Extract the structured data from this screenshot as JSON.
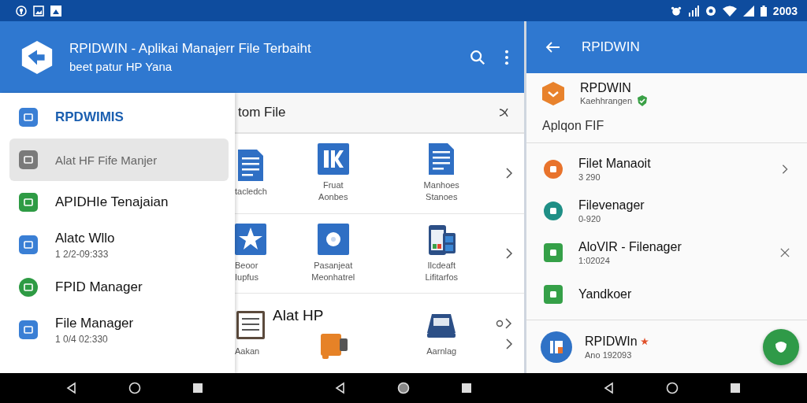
{
  "status_bar": {
    "time": "2003"
  },
  "main": {
    "app_bar": {
      "title": "RPIDWIN - Aplikai Manajerr File Terbaiht",
      "subtitle": "beet patur HP Yana"
    },
    "drawer": [
      {
        "kind": "brand",
        "label": "RPDWIMIS",
        "selected": false,
        "color": "#3a7fd5"
      },
      {
        "kind": "item",
        "label": "Alat HF Fife Manjer",
        "selected": true,
        "color": "#7a7a7a"
      },
      {
        "kind": "item",
        "label": "APIDHIe Tenajaian",
        "selected": false,
        "color": "#2e9b44"
      },
      {
        "kind": "item",
        "label": "Alatc Wllo",
        "detail": "1 2/2-09:333",
        "selected": false,
        "color": "#3a7fd5"
      },
      {
        "kind": "round",
        "label": "FPID Manager",
        "selected": false,
        "color": "#2e9b44"
      },
      {
        "kind": "item",
        "label": "File Manager",
        "detail": "1 0/4 02:330",
        "selected": false,
        "color": "#3a7fd5"
      }
    ],
    "search": {
      "value": "tom File"
    },
    "grid": [
      {
        "cells": [
          {
            "kind": "doc",
            "lines": [
              "tacledch"
            ]
          },
          {
            "kind": "letter",
            "lines": [
              "Fruat",
              "Aonbes"
            ]
          },
          {
            "kind": "doc",
            "lines": [
              "Manhoes",
              "Stanoes"
            ]
          }
        ],
        "actions": [
          {
            "kind": "chevron"
          }
        ]
      },
      {
        "cells": [
          {
            "kind": "star",
            "lines": [
              "Beoor",
              "Iupfus"
            ]
          },
          {
            "kind": "disc",
            "lines": [
              "Pasanjeat",
              "Meonhatrel"
            ]
          },
          {
            "kind": "phone",
            "lines": [
              "Ilcdeaft",
              "Lifitarfos"
            ]
          }
        ],
        "actions": [
          {
            "kind": "chevron"
          }
        ]
      },
      {
        "cells": [
          {
            "kind": "list",
            "lines": [
              "Aakan"
            ]
          },
          {
            "kind": "box",
            "heading": "Alat HP"
          },
          {
            "kind": "scanner",
            "lines": [
              "Aarnlag"
            ]
          }
        ],
        "actions": [
          {
            "kind": "ring"
          },
          {
            "kind": "chevron"
          }
        ]
      }
    ]
  },
  "side": {
    "app_bar": {
      "title": "RPIDWIN"
    },
    "app": {
      "name": "RPDWIN",
      "detail": "Kaehhrangen"
    },
    "section": "Aplqon FIF",
    "files": [
      {
        "kind": "circle",
        "name": "Filet Manaoit",
        "detail": "3 290",
        "color": "#e8732c",
        "actions": [
          {
            "kind": "chevron"
          }
        ]
      },
      {
        "kind": "circle",
        "name": "Filevenager",
        "detail": "0-920",
        "color": "#1f8f86"
      },
      {
        "kind": "square",
        "name": "AloVIR - Filenager",
        "detail": "1:02024",
        "color": "#35a048",
        "actions": [
          {
            "kind": "close"
          }
        ]
      },
      {
        "kind": "square",
        "name": "Yandkoer",
        "color": "#35a048"
      }
    ],
    "footer": {
      "name": "RPIDWIn",
      "detail": "Ano 192093"
    }
  }
}
